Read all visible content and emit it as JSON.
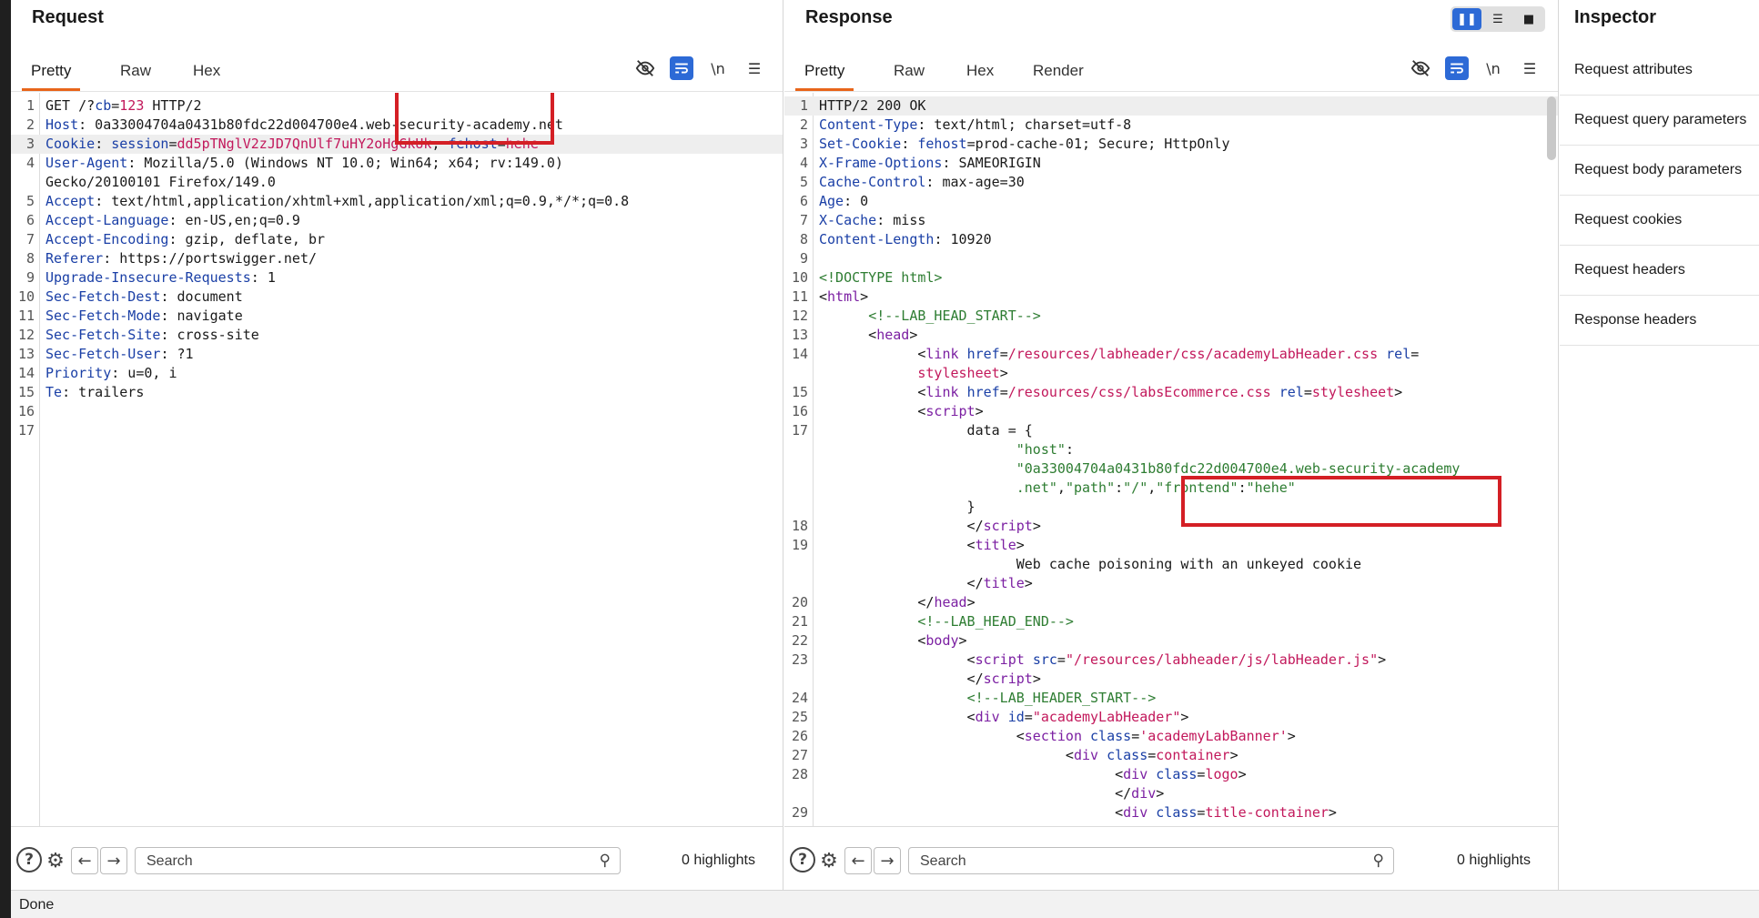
{
  "request": {
    "title": "Request",
    "tabs": [
      "Pretty",
      "Raw",
      "Hex"
    ],
    "lines": [
      {
        "n": "1",
        "segs": [
          [
            "n",
            "GET /?"
          ],
          [
            "k",
            "cb"
          ],
          [
            "n",
            "="
          ],
          [
            "r",
            "123"
          ],
          [
            "n",
            " HTTP/2"
          ]
        ]
      },
      {
        "n": "2",
        "segs": [
          [
            "k",
            "Host"
          ],
          [
            "n",
            ": 0a33004704a0431b80fdc22d004700e4.web-security-academy.net"
          ]
        ]
      },
      {
        "n": "3",
        "hl": true,
        "segs": [
          [
            "k",
            "Cookie"
          ],
          [
            "n",
            ": "
          ],
          [
            "k",
            "session"
          ],
          [
            "n",
            "="
          ],
          [
            "r",
            "dd5pTNglV2zJD7QnUlf7uHY2oHgGkUk"
          ],
          [
            "n",
            "; "
          ],
          [
            "k",
            "fehost"
          ],
          [
            "n",
            "="
          ],
          [
            "r",
            "hehe"
          ]
        ]
      },
      {
        "n": "4",
        "segs": [
          [
            "k",
            "User-Agent"
          ],
          [
            "n",
            ": Mozilla/5.0 (Windows NT 10.0; Win64; x64; rv:149.0)"
          ]
        ]
      },
      {
        "n": "",
        "segs": [
          [
            "n",
            "Gecko/20100101 Firefox/149.0"
          ]
        ]
      },
      {
        "n": "5",
        "segs": [
          [
            "k",
            "Accept"
          ],
          [
            "n",
            ": text/html,application/xhtml+xml,application/xml;q=0.9,*/*;q=0.8"
          ]
        ]
      },
      {
        "n": "6",
        "segs": [
          [
            "k",
            "Accept-Language"
          ],
          [
            "n",
            ": en-US,en;q=0.9"
          ]
        ]
      },
      {
        "n": "7",
        "segs": [
          [
            "k",
            "Accept-Encoding"
          ],
          [
            "n",
            ": gzip, deflate, br"
          ]
        ]
      },
      {
        "n": "8",
        "segs": [
          [
            "k",
            "Referer"
          ],
          [
            "n",
            ": https://portswigger.net/"
          ]
        ]
      },
      {
        "n": "9",
        "segs": [
          [
            "k",
            "Upgrade-Insecure-Requests"
          ],
          [
            "n",
            ": 1"
          ]
        ]
      },
      {
        "n": "10",
        "segs": [
          [
            "k",
            "Sec-Fetch-Dest"
          ],
          [
            "n",
            ": document"
          ]
        ]
      },
      {
        "n": "11",
        "segs": [
          [
            "k",
            "Sec-Fetch-Mode"
          ],
          [
            "n",
            ": navigate"
          ]
        ]
      },
      {
        "n": "12",
        "segs": [
          [
            "k",
            "Sec-Fetch-Site"
          ],
          [
            "n",
            ": cross-site"
          ]
        ]
      },
      {
        "n": "13",
        "segs": [
          [
            "k",
            "Sec-Fetch-User"
          ],
          [
            "n",
            ": ?1"
          ]
        ]
      },
      {
        "n": "14",
        "segs": [
          [
            "k",
            "Priority"
          ],
          [
            "n",
            ": u=0, i"
          ]
        ]
      },
      {
        "n": "15",
        "segs": [
          [
            "k",
            "Te"
          ],
          [
            "n",
            ": trailers"
          ]
        ]
      },
      {
        "n": "16",
        "segs": []
      },
      {
        "n": "17",
        "segs": []
      }
    ],
    "search_placeholder": "Search",
    "highlights": "0 highlights"
  },
  "response": {
    "title": "Response",
    "tabs": [
      "Pretty",
      "Raw",
      "Hex",
      "Render"
    ],
    "lines": [
      {
        "n": "1",
        "hl": true,
        "segs": [
          [
            "n",
            "HTTP/2 200 OK"
          ]
        ]
      },
      {
        "n": "2",
        "segs": [
          [
            "k",
            "Content-Type"
          ],
          [
            "n",
            ": text/html; charset=utf-8"
          ]
        ]
      },
      {
        "n": "3",
        "segs": [
          [
            "k",
            "Set-Cookie"
          ],
          [
            "n",
            ": "
          ],
          [
            "k",
            "fehost"
          ],
          [
            "n",
            "=prod-cache-01; Secure; HttpOnly"
          ]
        ]
      },
      {
        "n": "4",
        "segs": [
          [
            "k",
            "X-Frame-Options"
          ],
          [
            "n",
            ": SAMEORIGIN"
          ]
        ]
      },
      {
        "n": "5",
        "segs": [
          [
            "k",
            "Cache-Control"
          ],
          [
            "n",
            ": max-age=30"
          ]
        ]
      },
      {
        "n": "6",
        "segs": [
          [
            "k",
            "Age"
          ],
          [
            "n",
            ": 0"
          ]
        ]
      },
      {
        "n": "7",
        "segs": [
          [
            "k",
            "X-Cache"
          ],
          [
            "n",
            ": miss"
          ]
        ]
      },
      {
        "n": "8",
        "segs": [
          [
            "k",
            "Content-Length"
          ],
          [
            "n",
            ": 10920"
          ]
        ]
      },
      {
        "n": "9",
        "segs": []
      },
      {
        "n": "10",
        "segs": [
          [
            "g",
            "<!DOCTYPE html>"
          ]
        ]
      },
      {
        "n": "11",
        "segs": [
          [
            "n",
            "<"
          ],
          [
            "p",
            "html"
          ],
          [
            "n",
            ">"
          ]
        ]
      },
      {
        "n": "12",
        "segs": [
          [
            "n",
            "      "
          ],
          [
            "g",
            "<!--LAB_HEAD_START-->"
          ]
        ]
      },
      {
        "n": "13",
        "segs": [
          [
            "n",
            "      <"
          ],
          [
            "p",
            "head"
          ],
          [
            "n",
            ">"
          ]
        ]
      },
      {
        "n": "14",
        "segs": [
          [
            "n",
            "            <"
          ],
          [
            "p",
            "link"
          ],
          [
            "n",
            " "
          ],
          [
            "k",
            "href"
          ],
          [
            "n",
            "="
          ],
          [
            "r",
            "/resources/labheader/css/academyLabHeader.css"
          ],
          [
            "n",
            " "
          ],
          [
            "k",
            "rel"
          ],
          [
            "n",
            "="
          ]
        ]
      },
      {
        "n": "",
        "segs": [
          [
            "n",
            "            "
          ],
          [
            "r",
            "stylesheet"
          ],
          [
            "n",
            ">"
          ]
        ]
      },
      {
        "n": "15",
        "segs": [
          [
            "n",
            "            <"
          ],
          [
            "p",
            "link"
          ],
          [
            "n",
            " "
          ],
          [
            "k",
            "href"
          ],
          [
            "n",
            "="
          ],
          [
            "r",
            "/resources/css/labsEcommerce.css"
          ],
          [
            "n",
            " "
          ],
          [
            "k",
            "rel"
          ],
          [
            "n",
            "="
          ],
          [
            "r",
            "stylesheet"
          ],
          [
            "n",
            ">"
          ]
        ]
      },
      {
        "n": "16",
        "segs": [
          [
            "n",
            "            <"
          ],
          [
            "p",
            "script"
          ],
          [
            "n",
            ">"
          ]
        ]
      },
      {
        "n": "17",
        "segs": [
          [
            "n",
            "                  data = {"
          ]
        ]
      },
      {
        "n": "",
        "segs": [
          [
            "n",
            "                        "
          ],
          [
            "g",
            "\"host\""
          ],
          [
            "n",
            ":"
          ]
        ]
      },
      {
        "n": "",
        "segs": [
          [
            "n",
            "                        "
          ],
          [
            "g",
            "\"0a33004704a0431b80fdc22d004700e4.web-security-academy"
          ]
        ]
      },
      {
        "n": "",
        "segs": [
          [
            "n",
            "                        "
          ],
          [
            "g",
            ".net\""
          ],
          [
            "n",
            ","
          ],
          [
            "g",
            "\"path\""
          ],
          [
            "n",
            ":"
          ],
          [
            "g",
            "\"/\""
          ],
          [
            "n",
            ","
          ],
          [
            "g",
            "\"frontend\""
          ],
          [
            "n",
            ":"
          ],
          [
            "g",
            "\"hehe\""
          ]
        ]
      },
      {
        "n": "",
        "segs": [
          [
            "n",
            "                  }"
          ]
        ]
      },
      {
        "n": "18",
        "segs": [
          [
            "n",
            "                  </"
          ],
          [
            "p",
            "script"
          ],
          [
            "n",
            ">"
          ]
        ]
      },
      {
        "n": "19",
        "segs": [
          [
            "n",
            "                  <"
          ],
          [
            "p",
            "title"
          ],
          [
            "n",
            ">"
          ]
        ]
      },
      {
        "n": "",
        "segs": [
          [
            "n",
            "                        Web cache poisoning with an unkeyed cookie"
          ]
        ]
      },
      {
        "n": "",
        "segs": [
          [
            "n",
            "                  </"
          ],
          [
            "p",
            "title"
          ],
          [
            "n",
            ">"
          ]
        ]
      },
      {
        "n": "20",
        "segs": [
          [
            "n",
            "            </"
          ],
          [
            "p",
            "head"
          ],
          [
            "n",
            ">"
          ]
        ]
      },
      {
        "n": "21",
        "segs": [
          [
            "n",
            "            "
          ],
          [
            "g",
            "<!--LAB_HEAD_END-->"
          ]
        ]
      },
      {
        "n": "22",
        "segs": [
          [
            "n",
            "            <"
          ],
          [
            "p",
            "body"
          ],
          [
            "n",
            ">"
          ]
        ]
      },
      {
        "n": "23",
        "segs": [
          [
            "n",
            "                  <"
          ],
          [
            "p",
            "script"
          ],
          [
            "n",
            " "
          ],
          [
            "k",
            "src"
          ],
          [
            "n",
            "="
          ],
          [
            "r",
            "\"/resources/labheader/js/labHeader.js\""
          ],
          [
            "n",
            ">"
          ]
        ]
      },
      {
        "n": "",
        "segs": [
          [
            "n",
            "                  </"
          ],
          [
            "p",
            "script"
          ],
          [
            "n",
            ">"
          ]
        ]
      },
      {
        "n": "24",
        "segs": [
          [
            "n",
            "                  "
          ],
          [
            "g",
            "<!--LAB_HEADER_START-->"
          ]
        ]
      },
      {
        "n": "25",
        "segs": [
          [
            "n",
            "                  <"
          ],
          [
            "p",
            "div"
          ],
          [
            "n",
            " "
          ],
          [
            "k",
            "id"
          ],
          [
            "n",
            "="
          ],
          [
            "r",
            "\"academyLabHeader\""
          ],
          [
            "n",
            ">"
          ]
        ]
      },
      {
        "n": "26",
        "segs": [
          [
            "n",
            "                        <"
          ],
          [
            "p",
            "section"
          ],
          [
            "n",
            " "
          ],
          [
            "k",
            "class"
          ],
          [
            "n",
            "="
          ],
          [
            "r",
            "'academyLabBanner'"
          ],
          [
            "n",
            ">"
          ]
        ]
      },
      {
        "n": "27",
        "segs": [
          [
            "n",
            "                              <"
          ],
          [
            "p",
            "div"
          ],
          [
            "n",
            " "
          ],
          [
            "k",
            "class"
          ],
          [
            "n",
            "="
          ],
          [
            "r",
            "container"
          ],
          [
            "n",
            ">"
          ]
        ]
      },
      {
        "n": "28",
        "segs": [
          [
            "n",
            "                                    <"
          ],
          [
            "p",
            "div"
          ],
          [
            "n",
            " "
          ],
          [
            "k",
            "class"
          ],
          [
            "n",
            "="
          ],
          [
            "r",
            "logo"
          ],
          [
            "n",
            ">"
          ]
        ]
      },
      {
        "n": "",
        "segs": [
          [
            "n",
            "                                    </"
          ],
          [
            "p",
            "div"
          ],
          [
            "n",
            ">"
          ]
        ]
      },
      {
        "n": "29",
        "segs": [
          [
            "n",
            "                                    <"
          ],
          [
            "p",
            "div"
          ],
          [
            "n",
            " "
          ],
          [
            "k",
            "class"
          ],
          [
            "n",
            "="
          ],
          [
            "r",
            "title-container"
          ],
          [
            "n",
            ">"
          ]
        ]
      }
    ],
    "search_placeholder": "Search",
    "highlights": "0 highlights"
  },
  "inspector": {
    "title": "Inspector",
    "items": [
      "Request attributes",
      "Request query parameters",
      "Request body parameters",
      "Request cookies",
      "Request headers",
      "Response headers"
    ]
  },
  "status": "Done",
  "colors": {
    "accent_tab": "#e8651a",
    "highlight_box": "#d41f25",
    "toggle_blue": "#2d6ad6"
  }
}
